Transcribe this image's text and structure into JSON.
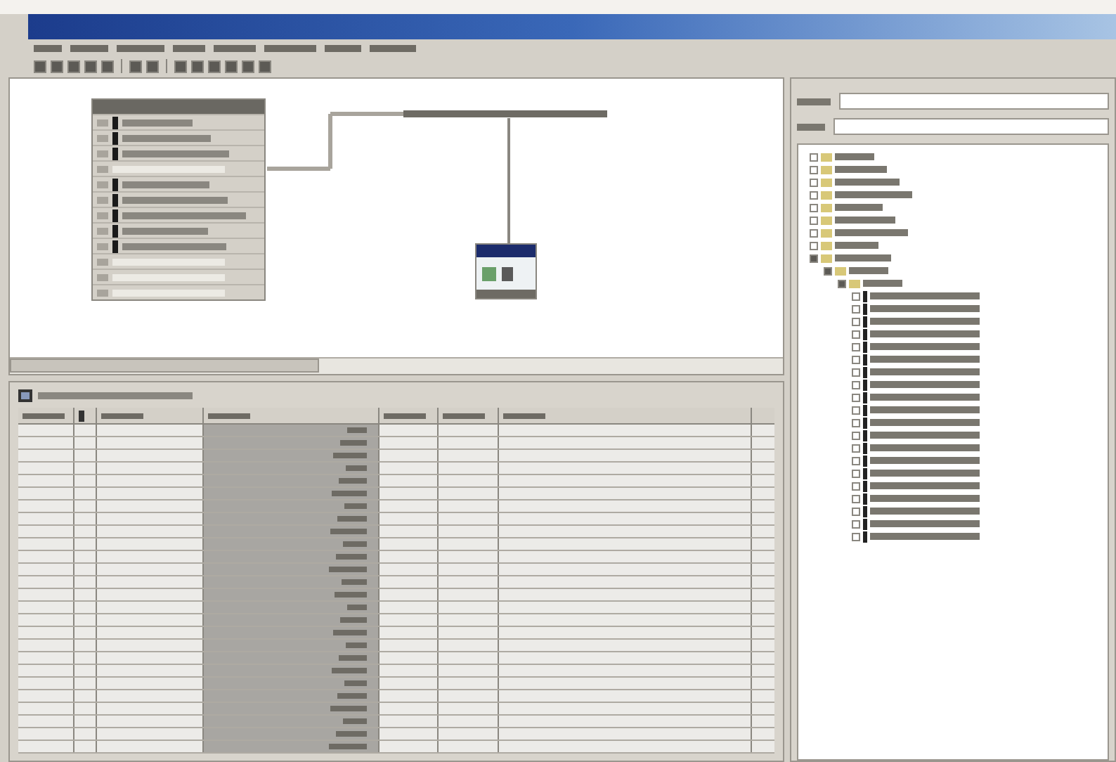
{
  "window": {
    "active": true
  },
  "menu_bar": {
    "items": [
      {
        "kind": "menu"
      },
      {
        "kind": "menu"
      },
      {
        "kind": "menu"
      },
      {
        "kind": "menu"
      },
      {
        "kind": "menu"
      },
      {
        "kind": "menu"
      },
      {
        "kind": "menu"
      },
      {
        "kind": "menu"
      }
    ]
  },
  "toolbar": {
    "buttons": [
      {
        "kind": "tool"
      },
      {
        "kind": "tool"
      },
      {
        "kind": "tool"
      },
      {
        "kind": "tool"
      },
      {
        "kind": "tool"
      },
      {
        "kind": "separator"
      },
      {
        "kind": "tool"
      },
      {
        "kind": "tool"
      },
      {
        "kind": "separator"
      },
      {
        "kind": "tool"
      },
      {
        "kind": "tool"
      },
      {
        "kind": "tool"
      },
      {
        "kind": "tool"
      },
      {
        "kind": "tool"
      },
      {
        "kind": "tool"
      }
    ]
  },
  "network_view": {
    "station": {
      "slots": [
        {
          "kind": "module"
        },
        {
          "kind": "module"
        },
        {
          "kind": "module"
        },
        {
          "kind": "empty"
        },
        {
          "kind": "module"
        },
        {
          "kind": "module"
        },
        {
          "kind": "module"
        },
        {
          "kind": "module"
        },
        {
          "kind": "module"
        },
        {
          "kind": "empty"
        },
        {
          "kind": "empty"
        },
        {
          "kind": "empty"
        }
      ]
    },
    "subnet": {
      "kind": "bus"
    },
    "device": {
      "kind": "device"
    }
  },
  "details_view": {
    "columns": [
      {
        "kind": "text"
      },
      {
        "kind": "icon"
      },
      {
        "kind": "text"
      },
      {
        "kind": "text"
      },
      {
        "kind": "text"
      },
      {
        "kind": "text"
      },
      {
        "kind": "text"
      }
    ],
    "rows": [
      {
        "selected": false
      },
      {
        "selected": false
      },
      {
        "selected": false
      },
      {
        "selected": false
      },
      {
        "selected": false
      },
      {
        "selected": false
      },
      {
        "selected": false
      },
      {
        "selected": false
      },
      {
        "selected": false
      },
      {
        "selected": false
      },
      {
        "selected": false
      },
      {
        "selected": false
      },
      {
        "selected": false
      },
      {
        "selected": false
      },
      {
        "selected": false
      },
      {
        "selected": false
      },
      {
        "selected": false
      },
      {
        "selected": false
      },
      {
        "selected": false
      },
      {
        "selected": false
      },
      {
        "selected": false
      },
      {
        "selected": false
      },
      {
        "selected": false
      },
      {
        "selected": false
      },
      {
        "selected": false
      },
      {
        "selected": false
      }
    ]
  },
  "catalog": {
    "tree": [
      {
        "expanded": false
      },
      {
        "expanded": false
      },
      {
        "expanded": false
      },
      {
        "expanded": false
      },
      {
        "expanded": false
      },
      {
        "expanded": false
      },
      {
        "expanded": false
      },
      {
        "expanded": false
      },
      {
        "expanded": true,
        "children": [
          {
            "expanded": true,
            "children": [
              {
                "expanded": true,
                "children": [
                  {
                    "expanded": false
                  },
                  {
                    "expanded": false
                  },
                  {
                    "expanded": false
                  },
                  {
                    "expanded": false
                  },
                  {
                    "expanded": false
                  },
                  {
                    "expanded": false
                  },
                  {
                    "expanded": false
                  },
                  {
                    "expanded": false
                  },
                  {
                    "expanded": false
                  },
                  {
                    "expanded": false
                  },
                  {
                    "expanded": false
                  },
                  {
                    "expanded": false
                  },
                  {
                    "expanded": false
                  },
                  {
                    "expanded": false
                  },
                  {
                    "expanded": false
                  },
                  {
                    "expanded": false
                  },
                  {
                    "expanded": false
                  },
                  {
                    "expanded": false
                  },
                  {
                    "expanded": false
                  },
                  {
                    "expanded": false
                  }
                ]
              }
            ]
          }
        ]
      }
    ]
  }
}
